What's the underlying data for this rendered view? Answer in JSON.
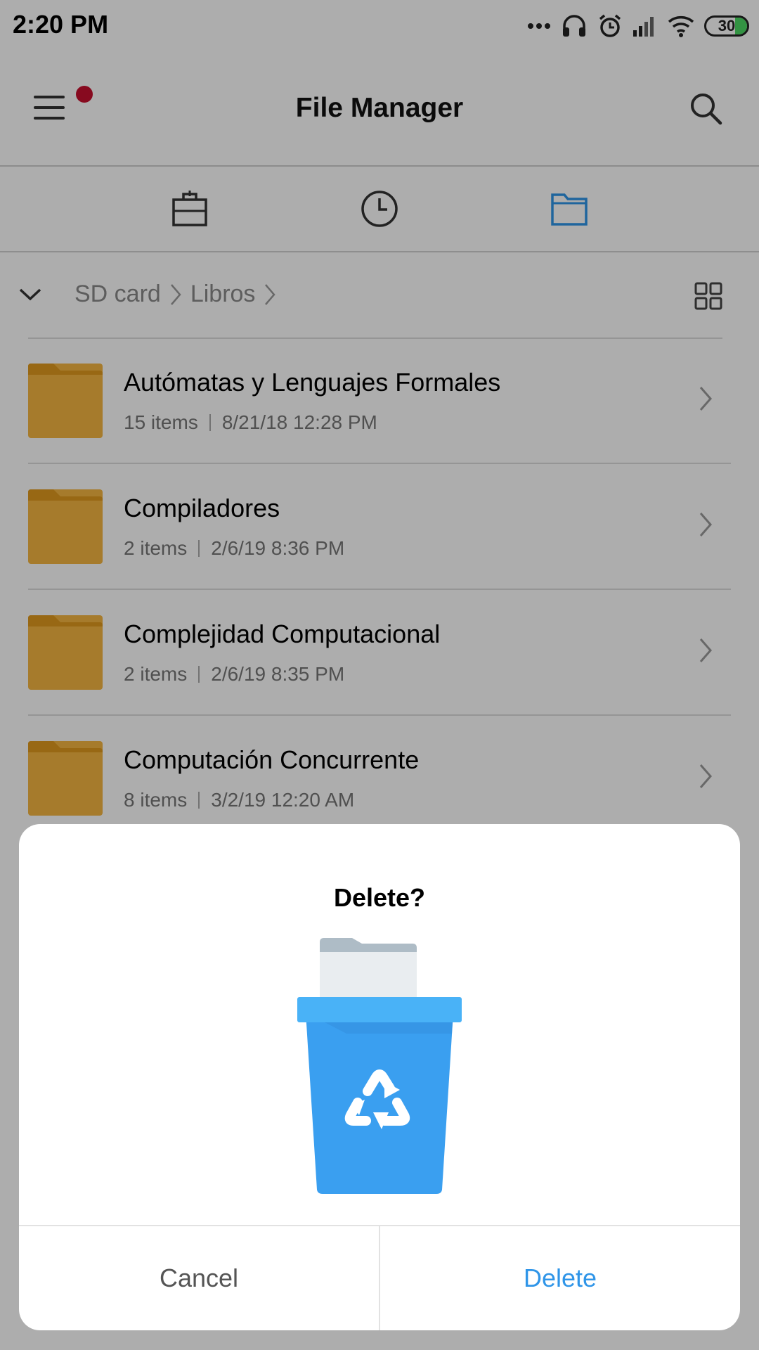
{
  "status_bar": {
    "time": "2:20 PM",
    "battery_level": "30",
    "icons": [
      "more-dots-icon",
      "headphones-icon",
      "alarm-icon",
      "signal-icon",
      "wifi-icon",
      "battery-icon"
    ]
  },
  "header": {
    "title": "File Manager",
    "menu_icon": "hamburger-menu-icon",
    "search_icon": "search-icon",
    "notification_dot_color": "#c8102e"
  },
  "tabs": [
    {
      "icon": "briefcase-icon",
      "active": false
    },
    {
      "icon": "clock-icon",
      "active": false
    },
    {
      "icon": "folder-icon",
      "active": true
    }
  ],
  "breadcrumb": {
    "items": [
      "SD card",
      "Libros"
    ],
    "toggle_icon": "chevron-down-icon",
    "view_icon": "grid-view-icon"
  },
  "folders": [
    {
      "name": "Autómatas y Lenguajes Formales",
      "items": "15 items",
      "date": "8/21/18 12:28 PM"
    },
    {
      "name": "Compiladores",
      "items": "2 items",
      "date": "2/6/19 8:36 PM"
    },
    {
      "name": "Complejidad Computacional",
      "items": "2 items",
      "date": "2/6/19 8:35 PM"
    },
    {
      "name": "Computación Concurrente",
      "items": "8 items",
      "date": "3/2/19 12:20 AM"
    }
  ],
  "dialog": {
    "title": "Delete?",
    "illustration_icon": "recycle-bin-icon",
    "cancel_label": "Cancel",
    "delete_label": "Delete"
  },
  "colors": {
    "accent": "#2f95e8",
    "folder": "#f5b642",
    "trash": "#3a9ff0"
  }
}
